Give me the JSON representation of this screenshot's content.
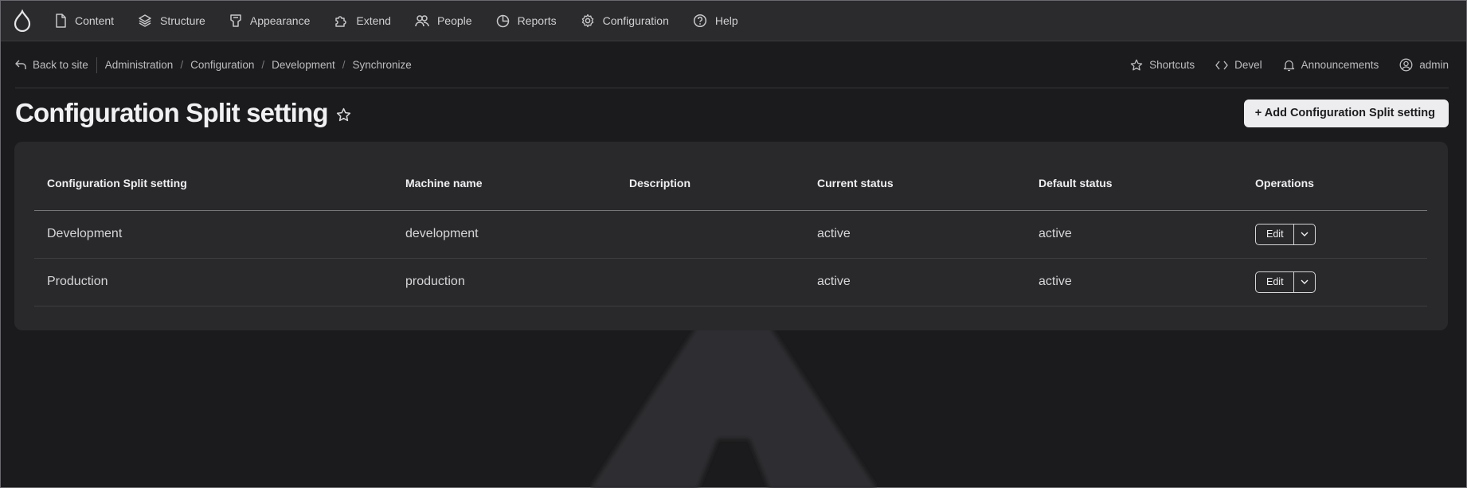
{
  "toolbar": {
    "logo_icon": "drupal-drop-icon",
    "items": [
      {
        "label": "Content",
        "icon": "file-icon"
      },
      {
        "label": "Structure",
        "icon": "layers-icon"
      },
      {
        "label": "Appearance",
        "icon": "paintbrush-icon"
      },
      {
        "label": "Extend",
        "icon": "puzzle-icon"
      },
      {
        "label": "People",
        "icon": "people-icon"
      },
      {
        "label": "Reports",
        "icon": "pie-chart-icon"
      },
      {
        "label": "Configuration",
        "icon": "gear-icon"
      },
      {
        "label": "Help",
        "icon": "question-icon"
      }
    ]
  },
  "secondary": {
    "back_label": "Back to site",
    "breadcrumb": [
      "Administration",
      "Configuration",
      "Development",
      "Synchronize"
    ],
    "right_items": [
      {
        "label": "Shortcuts",
        "icon": "star-icon"
      },
      {
        "label": "Devel",
        "icon": "code-icon"
      },
      {
        "label": "Announcements",
        "icon": "bell-icon"
      },
      {
        "label": "admin",
        "icon": "user-icon"
      }
    ]
  },
  "page": {
    "title": "Configuration Split setting",
    "add_button": "+ Add Configuration Split setting"
  },
  "table": {
    "headers": [
      "Configuration Split setting",
      "Machine name",
      "Description",
      "Current status",
      "Default status",
      "Operations"
    ],
    "rows": [
      {
        "name": "Development",
        "machine": "development",
        "description": "",
        "current": "active",
        "default": "active",
        "op": "Edit"
      },
      {
        "name": "Production",
        "machine": "production",
        "description": "",
        "current": "active",
        "default": "active",
        "op": "Edit"
      }
    ]
  },
  "colors": {
    "background": "#1b1b1d",
    "toolbar": "#2b2b2e",
    "card": "#29292c",
    "primary_button": "#ededef"
  }
}
